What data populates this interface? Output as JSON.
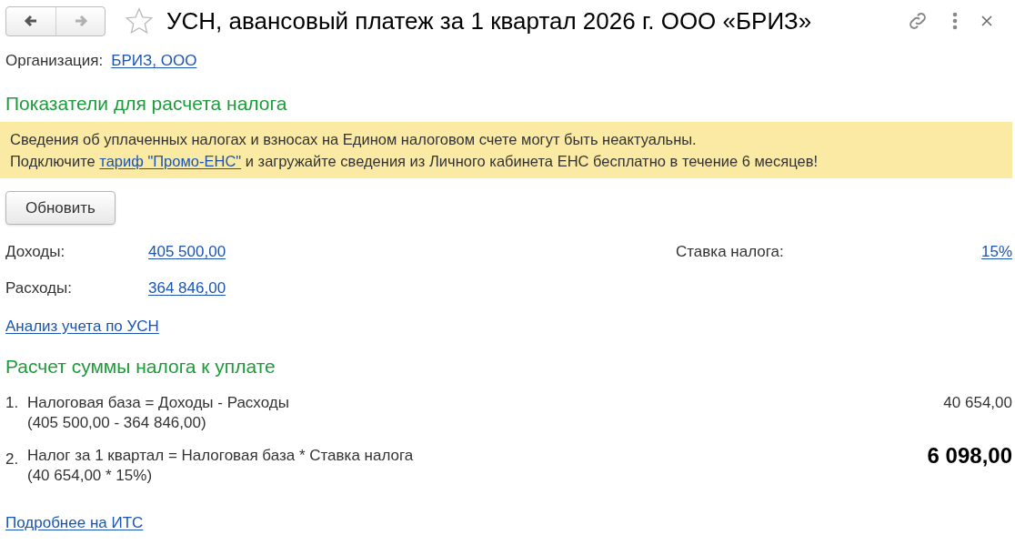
{
  "header": {
    "nav": [
      {
        "kind": "back",
        "disabled": false
      },
      {
        "kind": "forward",
        "disabled": true
      }
    ],
    "favorite": false,
    "title": "УСН, авансовый платеж за 1 квартал 2026 г. ООО «БРИЗ»"
  },
  "organization": {
    "label": "Организация:",
    "value": "БРИЗ, ООО"
  },
  "section_1": {
    "title": "Показатели для расчета налога"
  },
  "notice": {
    "line_1": "Сведения об уплаченных налогах и взносах на Едином налоговом счете могут быть неактуальны.",
    "line_2_before": "Подключите",
    "line_2_link": "тариф \"Промо-ЕНС\"",
    "line_2_after": "и загружайте сведения из Личного кабинета ЕНС бесплатно в течение 6 месяцев!"
  },
  "refresh_button": "Обновить",
  "indicators": [
    {
      "label": "Доходы:",
      "value": "405 500,00"
    },
    {
      "label": "Расходы:",
      "value": "364 846,00"
    }
  ],
  "rate": {
    "label": "Ставка налога:",
    "value": "15%"
  },
  "analysis_link": "Анализ учета по УСН",
  "section_2": {
    "title": "Расчет суммы налога к уплате"
  },
  "steps": [
    {
      "number": "1.",
      "formula": "Налоговая база = Доходы - Расходы",
      "detail": "(405 500,00 - 364 846,00)",
      "result": "40 654,00",
      "emphasis": false
    },
    {
      "number": "2.",
      "formula": "Налог за 1 квартал = Налоговая база * Ставка налога",
      "detail": "(40 654,00 * 15%)",
      "result": "6 098,00",
      "emphasis": true
    }
  ],
  "its_link": "Подробнее на ИТС"
}
